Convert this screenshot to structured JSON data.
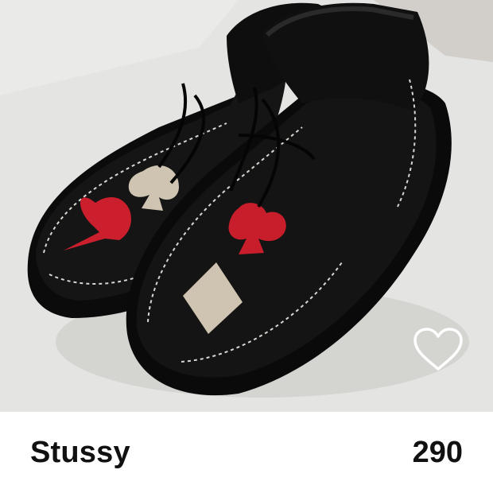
{
  "listing": {
    "brand": "Stussy",
    "price": "290"
  },
  "photo": {
    "subject": "shoes-photo",
    "favorite_icon": "heart-outline-icon"
  },
  "colors": {
    "text": "#111111",
    "background": "#ffffff",
    "icon": "#ffffff"
  }
}
